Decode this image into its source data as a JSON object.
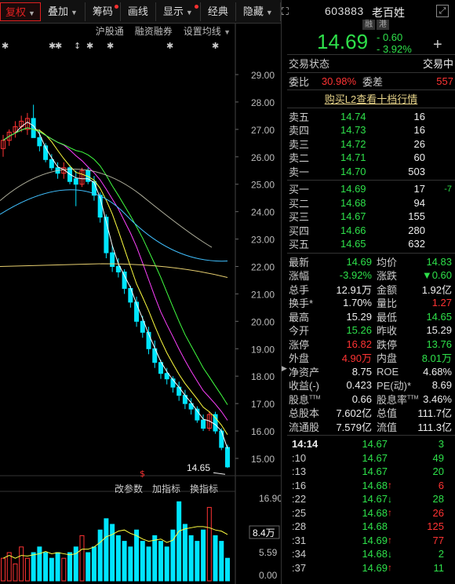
{
  "toolbar": {
    "items": [
      {
        "label": "复权",
        "active": true,
        "caret": true
      },
      {
        "label": "叠加",
        "caret": true
      },
      {
        "label": "筹码",
        "dot": true
      },
      {
        "label": "画线"
      },
      {
        "label": "显示",
        "caret": true,
        "dot": true
      },
      {
        "label": "经典"
      },
      {
        "label": "隐藏",
        "caret": true
      }
    ]
  },
  "subbar": {
    "hgt": "沪股通",
    "margin": "融资融券",
    "setma": "设置均线"
  },
  "lower_tabs": {
    "params": "改参数",
    "add": "加指标",
    "switch": "换指标"
  },
  "price_axis": [
    "29.00",
    "28.00",
    "27.00",
    "26.00",
    "25.00",
    "24.00",
    "23.00",
    "22.00",
    "21.00",
    "20.00",
    "19.00",
    "18.00",
    "17.00",
    "16.00",
    "15.00"
  ],
  "volume_axis": [
    "16.90",
    "8.4万",
    "5.59",
    "0.00"
  ],
  "low_label": "14.65",
  "colors": {
    "up": "#ff3333",
    "down": "#00e5ff",
    "ma5": "#ffffff",
    "ma10": "#ffff40",
    "ma20": "#ff40ff",
    "ma30": "#40ff40",
    "ma60": "#40c0ff",
    "ma120": "#e8d070"
  },
  "chart_data": {
    "type": "candlestick",
    "ylim": [
      14.5,
      29.8
    ],
    "candles": [
      [
        26.3,
        26.8,
        26.0,
        26.6
      ],
      [
        26.6,
        27.0,
        26.4,
        26.9
      ],
      [
        26.9,
        27.3,
        26.7,
        27.1
      ],
      [
        27.1,
        27.5,
        26.9,
        27.3
      ],
      [
        27.0,
        27.6,
        26.8,
        27.4
      ],
      [
        27.4,
        27.9,
        27.0,
        26.7
      ],
      [
        26.7,
        27.0,
        26.2,
        26.4
      ],
      [
        26.4,
        26.5,
        25.8,
        25.9
      ],
      [
        25.9,
        26.1,
        25.5,
        25.6
      ],
      [
        25.6,
        25.8,
        25.2,
        25.4
      ],
      [
        25.4,
        25.8,
        25.2,
        25.6
      ],
      [
        25.6,
        25.7,
        25.0,
        25.1
      ],
      [
        25.2,
        25.5,
        24.2,
        25.0
      ],
      [
        25.0,
        25.6,
        24.9,
        25.5
      ],
      [
        25.5,
        25.6,
        25.0,
        25.1
      ],
      [
        25.1,
        25.3,
        24.4,
        24.6
      ],
      [
        24.6,
        24.7,
        23.6,
        23.8
      ],
      [
        23.8,
        23.9,
        22.3,
        22.5
      ],
      [
        22.5,
        22.8,
        21.8,
        22.0
      ],
      [
        22.0,
        22.3,
        21.6,
        21.8
      ],
      [
        21.8,
        21.9,
        21.0,
        21.2
      ],
      [
        21.2,
        21.3,
        20.5,
        20.7
      ],
      [
        20.7,
        20.9,
        19.8,
        20.0
      ],
      [
        20.0,
        20.2,
        19.4,
        19.6
      ],
      [
        19.6,
        19.8,
        18.8,
        19.0
      ],
      [
        19.0,
        19.3,
        18.3,
        18.5
      ],
      [
        18.5,
        18.6,
        17.9,
        18.1
      ],
      [
        18.1,
        18.3,
        17.7,
        17.9
      ],
      [
        17.9,
        18.0,
        17.4,
        17.6
      ],
      [
        17.6,
        17.8,
        17.1,
        17.3
      ],
      [
        17.3,
        17.5,
        16.8,
        17.0
      ],
      [
        17.0,
        17.2,
        16.6,
        16.8
      ],
      [
        16.8,
        16.9,
        16.3,
        16.4
      ],
      [
        16.4,
        16.6,
        16.0,
        16.1
      ],
      [
        16.1,
        16.7,
        16.0,
        16.6
      ],
      [
        16.6,
        16.7,
        15.9,
        16.0
      ],
      [
        16.0,
        16.1,
        15.3,
        15.4
      ],
      [
        15.4,
        15.5,
        14.65,
        14.69
      ]
    ],
    "ma_lines": [
      "MA5",
      "MA10",
      "MA20",
      "MA30",
      "MA60",
      "MA120"
    ]
  },
  "stock": {
    "code": "603883",
    "name": "老百姓",
    "badges": [
      "融",
      "港"
    ],
    "price": "14.69",
    "change": "- 0.60",
    "pct": "- 3.92%"
  },
  "status": {
    "label": "交易状态",
    "value": "交易中"
  },
  "ratio": {
    "wb_label": "委比",
    "wb": "30.98%",
    "wc_label": "委差",
    "wc": "557"
  },
  "l2": "购买L2查看十档行情",
  "sell": [
    {
      "label": "卖五",
      "price": "14.74",
      "vol": "16"
    },
    {
      "label": "卖四",
      "price": "14.73",
      "vol": "16"
    },
    {
      "label": "卖三",
      "price": "14.72",
      "vol": "26"
    },
    {
      "label": "卖二",
      "price": "14.71",
      "vol": "60"
    },
    {
      "label": "卖一",
      "price": "14.70",
      "vol": "503"
    }
  ],
  "buy": [
    {
      "label": "买一",
      "price": "14.69",
      "vol": "17",
      "chg": "-7"
    },
    {
      "label": "买二",
      "price": "14.68",
      "vol": "94",
      "chg": ""
    },
    {
      "label": "买三",
      "price": "14.67",
      "vol": "155",
      "chg": ""
    },
    {
      "label": "买四",
      "price": "14.66",
      "vol": "280",
      "chg": ""
    },
    {
      "label": "买五",
      "price": "14.65",
      "vol": "632",
      "chg": ""
    }
  ],
  "quote": [
    {
      "k1": "最新",
      "v1": "14.69",
      "c1": "green",
      "k2": "均价",
      "v2": "14.83",
      "c2": "green"
    },
    {
      "k1": "涨幅",
      "v1": "-3.92%",
      "c1": "green",
      "k2": "涨跌",
      "v2": "▼0.60",
      "c2": "green"
    },
    {
      "k1": "总手",
      "v1": "12.91万",
      "c1": "white",
      "k2": "金额",
      "v2": "1.92亿",
      "c2": "white"
    },
    {
      "k1": "换手*",
      "v1": "1.70%",
      "c1": "white",
      "k2": "量比",
      "v2": "1.27",
      "c2": "red"
    },
    {
      "k1": "最高",
      "v1": "15.29",
      "c1": "white",
      "k2": "最低",
      "v2": "14.65",
      "c2": "green"
    },
    {
      "k1": "今开",
      "v1": "15.26",
      "c1": "green",
      "k2": "昨收",
      "v2": "15.29",
      "c2": "white"
    },
    {
      "k1": "涨停",
      "v1": "16.82",
      "c1": "red",
      "k2": "跌停",
      "v2": "13.76",
      "c2": "green"
    },
    {
      "k1": "外盘",
      "v1": "4.90万",
      "c1": "red",
      "k2": "内盘",
      "v2": "8.01万",
      "c2": "green"
    },
    {
      "k1": "净资产",
      "v1": "8.75",
      "c1": "white",
      "k2": "ROE",
      "v2": "4.68%",
      "c2": "white"
    },
    {
      "k1": "收益(-)",
      "v1": "0.423",
      "c1": "white",
      "k2": "PE(动)*",
      "v2": "8.69",
      "c2": "white"
    },
    {
      "k1": "股息TTM",
      "v1": "0.66",
      "c1": "white",
      "k2": "股息率TTM",
      "v2": "3.46%",
      "c2": "white"
    },
    {
      "k1": "总股本",
      "v1": "7.602亿",
      "c1": "white",
      "k2": "总值",
      "v2": "111.7亿",
      "c2": "white"
    },
    {
      "k1": "流通股",
      "v1": "7.579亿",
      "c1": "white",
      "k2": "流值",
      "v2": "111.3亿",
      "c2": "white"
    }
  ],
  "ticks": [
    {
      "time": "14:14",
      "price": "14.67",
      "arrow": "",
      "vol": "3",
      "vc": "green"
    },
    {
      "time": ":10",
      "price": "14.67",
      "arrow": "",
      "vol": "49",
      "vc": "green"
    },
    {
      "time": ":13",
      "price": "14.67",
      "arrow": "",
      "vol": "20",
      "vc": "green"
    },
    {
      "time": ":16",
      "price": "14.68",
      "arrow": "↑",
      "vol": "6",
      "vc": "red"
    },
    {
      "time": ":22",
      "price": "14.67",
      "arrow": "↓",
      "vol": "28",
      "vc": "green"
    },
    {
      "time": ":25",
      "price": "14.68",
      "arrow": "↑",
      "vol": "26",
      "vc": "red"
    },
    {
      "time": ":28",
      "price": "14.68",
      "arrow": "",
      "vol": "125",
      "vc": "red"
    },
    {
      "time": ":31",
      "price": "14.69",
      "arrow": "↑",
      "vol": "77",
      "vc": "red"
    },
    {
      "time": ":34",
      "price": "14.68",
      "arrow": "↓",
      "vol": "2",
      "vc": "green"
    },
    {
      "time": ":37",
      "price": "14.69",
      "arrow": "↑",
      "vol": "11",
      "vc": "green"
    }
  ]
}
